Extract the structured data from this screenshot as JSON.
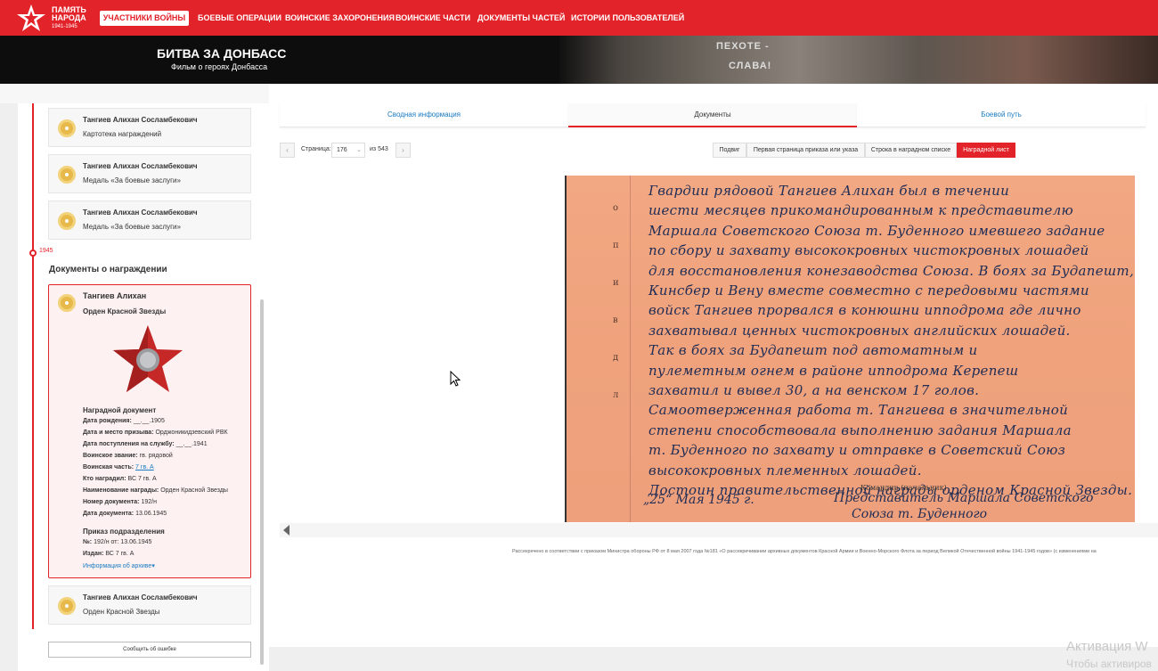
{
  "header": {
    "logo": {
      "line1": "ПАМЯТЬ",
      "line2": "НАРОДА",
      "years": "1941-1945"
    },
    "nav": [
      {
        "label": "УЧАСТНИКИ ВОЙНЫ",
        "active": true
      },
      {
        "label": "БОЕВЫЕ ОПЕРАЦИИ"
      },
      {
        "label": "ВОИНСКИЕ ЗАХОРОНЕНИЯ"
      },
      {
        "label": "ВОИНСКИЕ ЧАСТИ"
      },
      {
        "label": "ДОКУМЕНТЫ ЧАСТЕЙ"
      },
      {
        "label": "ИСТОРИИ ПОЛЬЗОВАТЕЛЕЙ"
      }
    ],
    "colors": {
      "brand": "#e3232a"
    }
  },
  "banner": {
    "title": "БИТВА ЗА ДОНБАСС",
    "subtitle": "Фильм о героях Донбасса",
    "image_words": [
      "ПЕХОТЕ -",
      "СЛАВА!"
    ]
  },
  "sidebar": {
    "awards_top": [
      {
        "name": "Тангиев Алихан Сосламбекович",
        "type": "Картотека награждений"
      },
      {
        "name": "Тангиев Алихан Сосламбекович",
        "type": "Медаль «За боевые заслуги»"
      },
      {
        "name": "Тангиев Алихан Сосламбекович",
        "type": "Медаль «За боевые заслуги»"
      }
    ],
    "year": "1945",
    "section_title": "Документы о награждении",
    "order_card": {
      "name": "Тангиев Алихан",
      "type": "Орден Красной Звезды",
      "doc_heading": "Наградной документ",
      "fields": [
        {
          "label": "Дата рождения:",
          "value": "__.__.1905"
        },
        {
          "label": "Дата и место призыва:",
          "value": "Орджоникидзевский РВК"
        },
        {
          "label": "Дата поступления на службу:",
          "value": "__.__.1941"
        },
        {
          "label": "Воинское звание:",
          "value": "гв. рядовой"
        },
        {
          "label": "Воинская часть:",
          "value": "7 гв. А"
        },
        {
          "label": "Кто наградил:",
          "value": "ВС 7 гв. А"
        },
        {
          "label": "Наименование награды:",
          "value": "Орден Красной Звезды"
        },
        {
          "label": "Номер документа:",
          "value": "192/н"
        },
        {
          "label": "Дата документа:",
          "value": "13.06.1945"
        }
      ],
      "order_heading": "Приказ подразделения",
      "order_fields": [
        {
          "label": "№:",
          "value": "192/н от: 13.06.1945"
        },
        {
          "label": "Издан:",
          "value": "ВС 7 гв. А"
        }
      ],
      "archive_link": "Информация об архиве"
    },
    "award_bottom": {
      "name": "Тангиев Алихан Сосламбекович",
      "type": "Орден Красной Звезды"
    },
    "error_button": "Сообщить об ошибке"
  },
  "tabs": [
    {
      "label": "Сводная информация"
    },
    {
      "label": "Документы",
      "active": true
    },
    {
      "label": "Боевой путь"
    }
  ],
  "pager": {
    "prev": "‹",
    "label": "Страница:",
    "page": "176",
    "of": "из 543",
    "next": "›"
  },
  "view_buttons": [
    {
      "label": "Подвиг"
    },
    {
      "label": "Первая страница приказа или указа"
    },
    {
      "label": "Строка в наградном списке"
    },
    {
      "label": "Наградной лист",
      "active": true
    }
  ],
  "document": {
    "margin_letters": [
      "о",
      "п",
      "и",
      "в",
      "д",
      "л"
    ],
    "handwriting": [
      "Гвардии рядовой Тангиев Алихан был в течении",
      "шести месяцев прикомандированным к представителю",
      "Маршала Советского Союза т. Буденного имевшего задание",
      "по сбору и захвату высококровных чистокровных лошадей",
      "для восстановления конезаводства Союза. В боях за Будапешт,",
      "Кинсбер и Вену вместе совместно с передовыми частями",
      "войск Тангиев прорвался в конюшни ипподрома где лично",
      "захватывал ценных чистокровных английских лошадей.",
      "Так в боях за Будапешт под автоматным и",
      "пулеметным огнем в районе ипподрома Керепеш",
      "захватил и вывел 30, а на венском 17 голов.",
      "Самоотверженная работа т. Тангиева в значительной",
      "степени способствовала выполнению задания Маршала",
      "т. Буденного по захвату и отправке в Советский Союз",
      "высококровных племенных лошадей.",
      "Достоин правительственной награды орденом Красной Звезды."
    ],
    "commander_label": "Командир (начальник)",
    "sign_date": "„25“ Мая 1945 г.",
    "sign_line1": "Представитель Маршала Советского",
    "sign_line2": "Союза т. Буденного"
  },
  "footnote": "Рассекречено в соответствии с приказом Министра обороны РФ от 8 мая 2007 года №181 «О рассекречивании архивных документов Красной Армии и Военно-Морского Флота за период Великой Отечественной войны 1941-1945 годов» (с изменениями на",
  "watermark": {
    "line1": "Активация W",
    "line2": "Чтобы активиров"
  }
}
